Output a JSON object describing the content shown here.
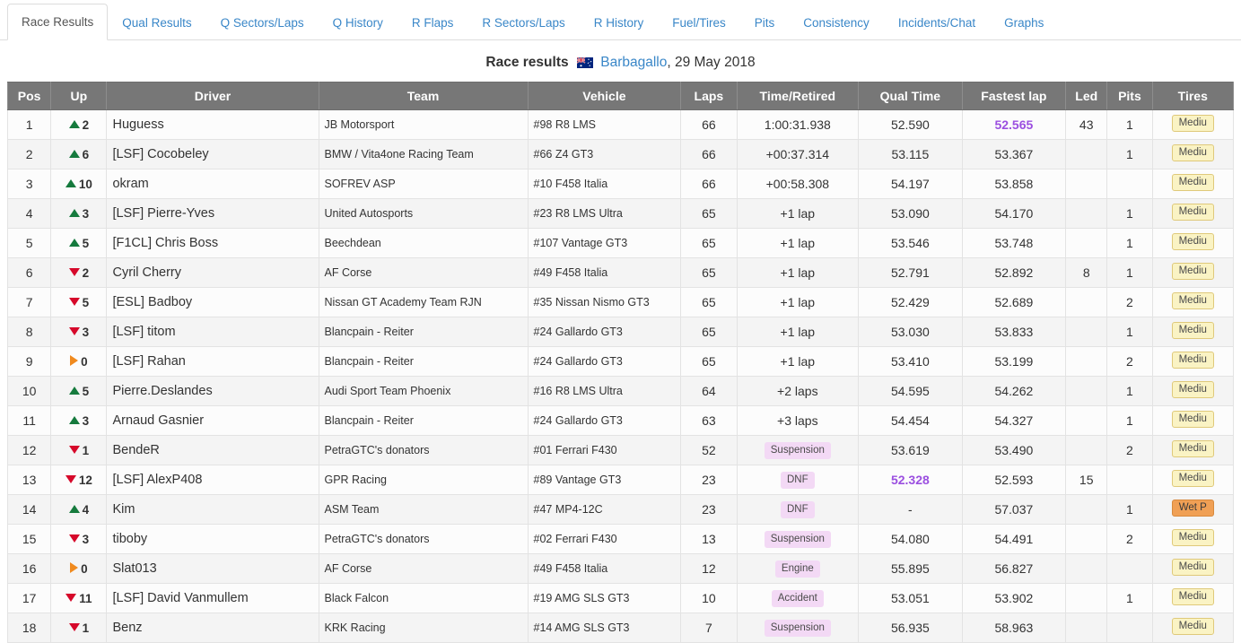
{
  "tabs": [
    {
      "label": "Race Results",
      "active": true
    },
    {
      "label": "Qual Results",
      "active": false
    },
    {
      "label": "Q Sectors/Laps",
      "active": false
    },
    {
      "label": "Q History",
      "active": false
    },
    {
      "label": "R Flaps",
      "active": false
    },
    {
      "label": "R Sectors/Laps",
      "active": false
    },
    {
      "label": "R History",
      "active": false
    },
    {
      "label": "Fuel/Tires",
      "active": false
    },
    {
      "label": "Pits",
      "active": false
    },
    {
      "label": "Consistency",
      "active": false
    },
    {
      "label": "Incidents/Chat",
      "active": false
    },
    {
      "label": "Graphs",
      "active": false
    }
  ],
  "header": {
    "title_prefix": "Race results",
    "flag_icon": "australia-flag-icon",
    "track": "Barbagallo",
    "date": ", 29 May 2018"
  },
  "table": {
    "columns": [
      "Pos",
      "Up",
      "Driver",
      "Team",
      "Vehicle",
      "Laps",
      "Time/Retired",
      "Qual Time",
      "Fastest lap",
      "Led",
      "Pits",
      "Tires"
    ],
    "rows": [
      {
        "pos": "1",
        "dir": "up",
        "delta": "2",
        "driver": "Huguess",
        "team": "JB Motorsport",
        "vehicle": "#98 R8 LMS",
        "laps": "66",
        "time": "1:00:31.938",
        "time_badge": false,
        "qual": "52.590",
        "fast": "52.565",
        "fast_purple": true,
        "led": "43",
        "pits": "1",
        "tires": "Mediu",
        "tires_wet": false
      },
      {
        "pos": "2",
        "dir": "up",
        "delta": "6",
        "driver": "[LSF] Cocobeley",
        "team": "BMW / Vita4one Racing Team",
        "vehicle": "#66 Z4 GT3",
        "laps": "66",
        "time": "+00:37.314",
        "time_badge": false,
        "qual": "53.115",
        "fast": "53.367",
        "fast_purple": false,
        "led": "",
        "pits": "1",
        "tires": "Mediu",
        "tires_wet": false
      },
      {
        "pos": "3",
        "dir": "up",
        "delta": "10",
        "driver": "okram",
        "team": "SOFREV ASP",
        "vehicle": "#10 F458 Italia",
        "laps": "66",
        "time": "+00:58.308",
        "time_badge": false,
        "qual": "54.197",
        "fast": "53.858",
        "fast_purple": false,
        "led": "",
        "pits": "",
        "tires": "Mediu",
        "tires_wet": false
      },
      {
        "pos": "4",
        "dir": "up",
        "delta": "3",
        "driver": "[LSF] Pierre-Yves",
        "team": "United Autosports",
        "vehicle": "#23 R8 LMS Ultra",
        "laps": "65",
        "time": "+1 lap",
        "time_badge": false,
        "qual": "53.090",
        "fast": "54.170",
        "fast_purple": false,
        "led": "",
        "pits": "1",
        "tires": "Mediu",
        "tires_wet": false
      },
      {
        "pos": "5",
        "dir": "up",
        "delta": "5",
        "driver": "[F1CL] Chris Boss",
        "team": "Beechdean",
        "vehicle": "#107 Vantage GT3",
        "laps": "65",
        "time": "+1 lap",
        "time_badge": false,
        "qual": "53.546",
        "fast": "53.748",
        "fast_purple": false,
        "led": "",
        "pits": "1",
        "tires": "Mediu",
        "tires_wet": false
      },
      {
        "pos": "6",
        "dir": "down",
        "delta": "2",
        "driver": "Cyril Cherry",
        "team": "AF Corse",
        "vehicle": "#49 F458 Italia",
        "laps": "65",
        "time": "+1 lap",
        "time_badge": false,
        "qual": "52.791",
        "fast": "52.892",
        "fast_purple": false,
        "led": "8",
        "pits": "1",
        "tires": "Mediu",
        "tires_wet": false
      },
      {
        "pos": "7",
        "dir": "down",
        "delta": "5",
        "driver": "[ESL] Badboy",
        "team": "Nissan GT Academy Team RJN",
        "vehicle": "#35 Nissan Nismo GT3",
        "laps": "65",
        "time": "+1 lap",
        "time_badge": false,
        "qual": "52.429",
        "fast": "52.689",
        "fast_purple": false,
        "led": "",
        "pits": "2",
        "tires": "Mediu",
        "tires_wet": false
      },
      {
        "pos": "8",
        "dir": "down",
        "delta": "3",
        "driver": "[LSF] titom",
        "team": "Blancpain - Reiter",
        "vehicle": "#24 Gallardo GT3",
        "laps": "65",
        "time": "+1 lap",
        "time_badge": false,
        "qual": "53.030",
        "fast": "53.833",
        "fast_purple": false,
        "led": "",
        "pits": "1",
        "tires": "Mediu",
        "tires_wet": false
      },
      {
        "pos": "9",
        "dir": "same",
        "delta": "0",
        "driver": "[LSF] Rahan",
        "team": "Blancpain - Reiter",
        "vehicle": "#24 Gallardo GT3",
        "laps": "65",
        "time": "+1 lap",
        "time_badge": false,
        "qual": "53.410",
        "fast": "53.199",
        "fast_purple": false,
        "led": "",
        "pits": "2",
        "tires": "Mediu",
        "tires_wet": false
      },
      {
        "pos": "10",
        "dir": "up",
        "delta": "5",
        "driver": "Pierre.Deslandes",
        "team": "Audi Sport Team Phoenix",
        "vehicle": "#16 R8 LMS Ultra",
        "laps": "64",
        "time": "+2 laps",
        "time_badge": false,
        "qual": "54.595",
        "fast": "54.262",
        "fast_purple": false,
        "led": "",
        "pits": "1",
        "tires": "Mediu",
        "tires_wet": false
      },
      {
        "pos": "11",
        "dir": "up",
        "delta": "3",
        "driver": "Arnaud Gasnier",
        "team": "Blancpain - Reiter",
        "vehicle": "#24 Gallardo GT3",
        "laps": "63",
        "time": "+3 laps",
        "time_badge": false,
        "qual": "54.454",
        "fast": "54.327",
        "fast_purple": false,
        "led": "",
        "pits": "1",
        "tires": "Mediu",
        "tires_wet": false
      },
      {
        "pos": "12",
        "dir": "down",
        "delta": "1",
        "driver": "BendeR",
        "team": "PetraGTC's donators",
        "vehicle": "#01 Ferrari F430",
        "laps": "52",
        "time": "Suspension",
        "time_badge": true,
        "qual": "53.619",
        "fast": "53.490",
        "fast_purple": false,
        "led": "",
        "pits": "2",
        "tires": "Mediu",
        "tires_wet": false
      },
      {
        "pos": "13",
        "dir": "down",
        "delta": "12",
        "driver": "[LSF] AlexP408",
        "team": "GPR Racing",
        "vehicle": "#89 Vantage GT3",
        "laps": "23",
        "time": "DNF",
        "time_badge": true,
        "qual": "52.328",
        "qual_purple": true,
        "fast": "52.593",
        "fast_purple": false,
        "led": "15",
        "pits": "",
        "tires": "Mediu",
        "tires_wet": false
      },
      {
        "pos": "14",
        "dir": "up",
        "delta": "4",
        "driver": "Kim",
        "team": "ASM Team",
        "vehicle": "#47 MP4-12C",
        "laps": "23",
        "time": "DNF",
        "time_badge": true,
        "qual": "-",
        "fast": "57.037",
        "fast_purple": false,
        "led": "",
        "pits": "1",
        "tires": "Wet P",
        "tires_wet": true
      },
      {
        "pos": "15",
        "dir": "down",
        "delta": "3",
        "driver": "tiboby",
        "team": "PetraGTC's donators",
        "vehicle": "#02 Ferrari F430",
        "laps": "13",
        "time": "Suspension",
        "time_badge": true,
        "qual": "54.080",
        "fast": "54.491",
        "fast_purple": false,
        "led": "",
        "pits": "2",
        "tires": "Mediu",
        "tires_wet": false
      },
      {
        "pos": "16",
        "dir": "same",
        "delta": "0",
        "driver": "Slat013",
        "team": "AF Corse",
        "vehicle": "#49 F458 Italia",
        "laps": "12",
        "time": "Engine",
        "time_badge": true,
        "qual": "55.895",
        "fast": "56.827",
        "fast_purple": false,
        "led": "",
        "pits": "",
        "tires": "Mediu",
        "tires_wet": false
      },
      {
        "pos": "17",
        "dir": "down",
        "delta": "11",
        "driver": "[LSF] David Vanmullem",
        "team": "Black Falcon",
        "vehicle": "#19 AMG SLS GT3",
        "laps": "10",
        "time": "Accident",
        "time_badge": true,
        "qual": "53.051",
        "fast": "53.902",
        "fast_purple": false,
        "led": "",
        "pits": "1",
        "tires": "Mediu",
        "tires_wet": false
      },
      {
        "pos": "18",
        "dir": "down",
        "delta": "1",
        "driver": "Benz",
        "team": "KRK Racing",
        "vehicle": "#14 AMG SLS GT3",
        "laps": "7",
        "time": "Suspension",
        "time_badge": true,
        "qual": "56.935",
        "fast": "58.963",
        "fast_purple": false,
        "led": "",
        "pits": "",
        "tires": "Mediu",
        "tires_wet": false
      }
    ]
  },
  "colors": {
    "header_bg": "#777777",
    "tab_link": "#3a87c8",
    "arrow_up": "#157a3d",
    "arrow_down": "#d6082a",
    "arrow_same": "#f08a1e",
    "purple_lap": "#9b4fe0",
    "badge_retired_bg": "#f3d9f5",
    "badge_tire_bg": "#faf3c4",
    "badge_wet_bg": "#f0a055"
  }
}
